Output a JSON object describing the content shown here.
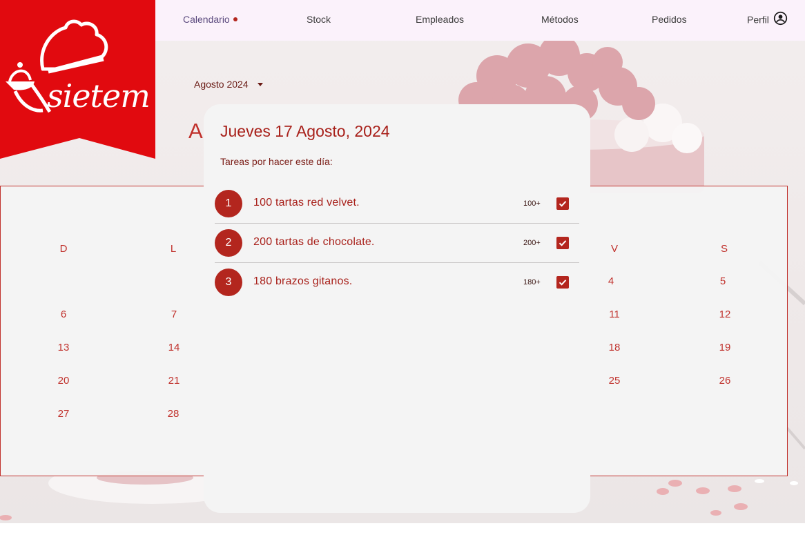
{
  "nav": {
    "items": [
      {
        "label": "Calendario",
        "active": true
      },
      {
        "label": "Stock",
        "active": false
      },
      {
        "label": "Empleados",
        "active": false
      },
      {
        "label": "Métodos",
        "active": false
      },
      {
        "label": "Pedidos",
        "active": false
      },
      {
        "label": "Perfil",
        "active": false
      }
    ]
  },
  "brand": {
    "name": "sietem",
    "color": "#e10a0f"
  },
  "calendar": {
    "month_select": "Agosto 2024",
    "month_heading_visible": "A",
    "weekday_headers": [
      "D",
      "L",
      "V",
      "S"
    ],
    "days": [
      "4",
      "5",
      "6",
      "7",
      "11",
      "12",
      "13",
      "14",
      "18",
      "19",
      "20",
      "21",
      "25",
      "26",
      "27",
      "28"
    ]
  },
  "dialog": {
    "title": "Jueves 17 Agosto, 2024",
    "subtitle": "Tareas por hacer este día:",
    "tasks": [
      {
        "number": "1",
        "text": "100 tartas red velvet.",
        "badge": "100+",
        "checked": true
      },
      {
        "number": "2",
        "text": "200 tartas de chocolate.",
        "badge": "200+",
        "checked": true
      },
      {
        "number": "3",
        "text": "180 brazos gitanos.",
        "badge": "180+",
        "checked": true
      }
    ]
  },
  "colors": {
    "accent": "#b3261e",
    "nav_bg": "#fbf2fb",
    "dialog_bg": "#f4f4f4"
  },
  "icons": {
    "profile": "account-circle-icon",
    "dropdown": "caret-down-icon",
    "check": "checkmark-icon"
  }
}
